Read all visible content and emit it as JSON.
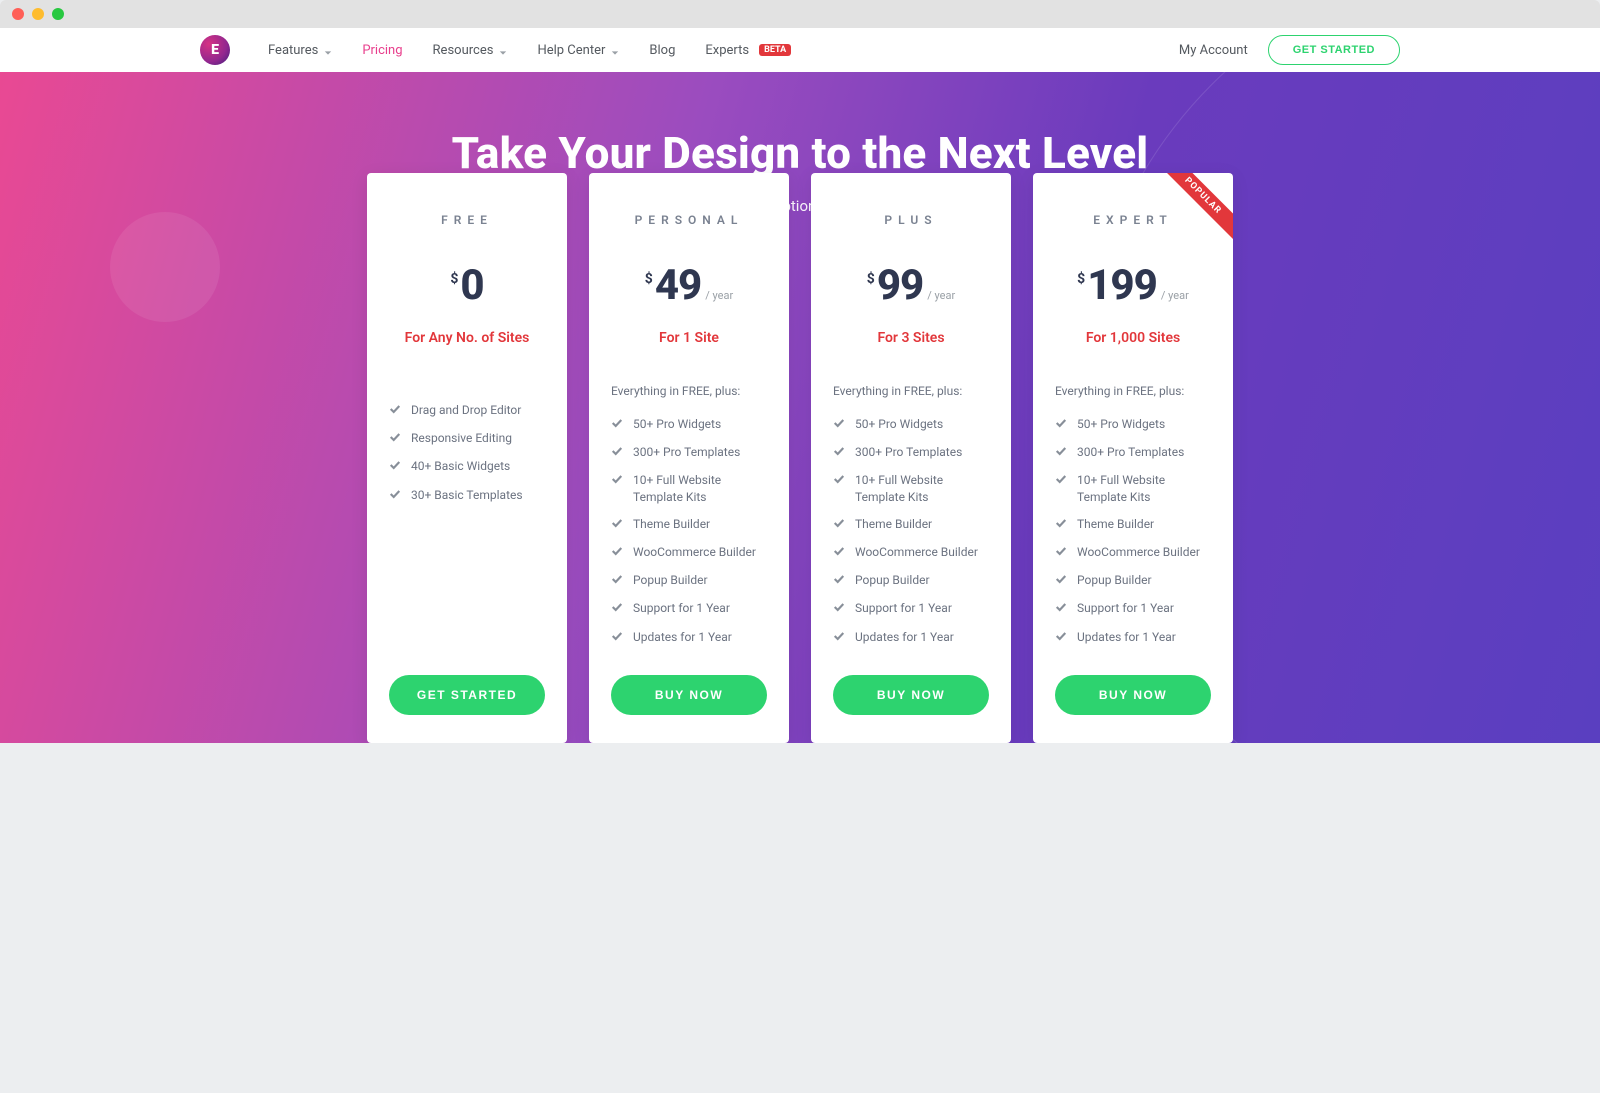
{
  "nav": {
    "items": [
      {
        "label": "Features",
        "hasDropdown": true
      },
      {
        "label": "Pricing",
        "active": true
      },
      {
        "label": "Resources",
        "hasDropdown": true
      },
      {
        "label": "Help Center",
        "hasDropdown": true
      },
      {
        "label": "Blog"
      },
      {
        "label": "Experts",
        "badge": "BETA"
      }
    ],
    "myAccount": "My Account",
    "getStarted": "GET STARTED"
  },
  "hero": {
    "title": "Take Your Design to the Next Level",
    "subtitle": "Choose your subscription plan and get started"
  },
  "pricing": {
    "currency": "$",
    "perYear": "/ year",
    "plans": [
      {
        "name": "FREE",
        "price": "0",
        "showPerYear": false,
        "tagline": "For Any No. of Sites",
        "intro": null,
        "features": [
          "Drag and Drop Editor",
          "Responsive Editing",
          "40+ Basic Widgets",
          "30+ Basic Templates"
        ],
        "cta": "GET STARTED",
        "popular": false
      },
      {
        "name": "PERSONAL",
        "price": "49",
        "showPerYear": true,
        "tagline": "For 1 Site",
        "intro": "Everything in FREE, plus:",
        "features": [
          "50+ Pro Widgets",
          "300+ Pro Templates",
          "10+ Full Website Template Kits",
          "Theme Builder",
          "WooCommerce Builder",
          "Popup Builder",
          "Support for 1 Year",
          "Updates for 1 Year"
        ],
        "cta": "BUY NOW",
        "popular": false
      },
      {
        "name": "PLUS",
        "price": "99",
        "showPerYear": true,
        "tagline": "For 3 Sites",
        "intro": "Everything in FREE, plus:",
        "features": [
          "50+ Pro Widgets",
          "300+ Pro Templates",
          "10+ Full Website Template Kits",
          "Theme Builder",
          "WooCommerce Builder",
          "Popup Builder",
          "Support for 1 Year",
          "Updates for 1 Year"
        ],
        "cta": "BUY NOW",
        "popular": false
      },
      {
        "name": "EXPERT",
        "price": "199",
        "showPerYear": true,
        "tagline": "For 1,000 Sites",
        "intro": "Everything in FREE, plus:",
        "features": [
          "50+ Pro Widgets",
          "300+ Pro Templates",
          "10+ Full Website Template Kits",
          "Theme Builder",
          "WooCommerce Builder",
          "Popup Builder",
          "Support for 1 Year",
          "Updates for 1 Year"
        ],
        "cta": "BUY NOW",
        "popular": true,
        "popularLabel": "POPULAR"
      }
    ]
  }
}
